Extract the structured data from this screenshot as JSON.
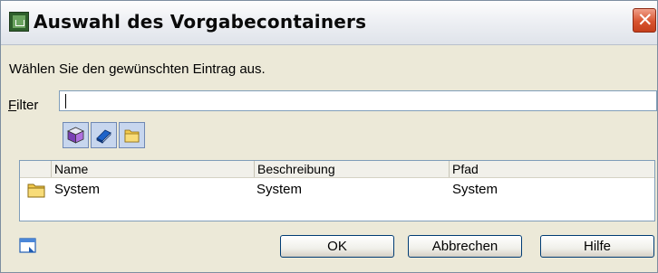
{
  "window": {
    "title": "Auswahl des Vorgabecontainers",
    "close_glyph": "✕",
    "app_icon": "app-icon"
  },
  "prompt": "Wählen Sie den gewünschten Eintrag aus.",
  "filter": {
    "label_underlined": "F",
    "label_rest": "ilter",
    "value": ""
  },
  "toolbar": {
    "buttons": [
      {
        "icon": "cube-icon"
      },
      {
        "icon": "book-icon"
      },
      {
        "icon": "folder-icon"
      }
    ]
  },
  "list": {
    "columns": [
      "Name",
      "Beschreibung",
      "Pfad"
    ],
    "rows": [
      {
        "icon": "folder-icon",
        "name": "System",
        "beschreibung": "System",
        "pfad": "System"
      }
    ]
  },
  "buttons": {
    "ok": "OK",
    "cancel": "Abbrechen",
    "help": "Hilfe"
  },
  "colors": {
    "dialog_bg": "#ece9d8",
    "close_red": "#d8542f",
    "input_border": "#7f9db9"
  }
}
